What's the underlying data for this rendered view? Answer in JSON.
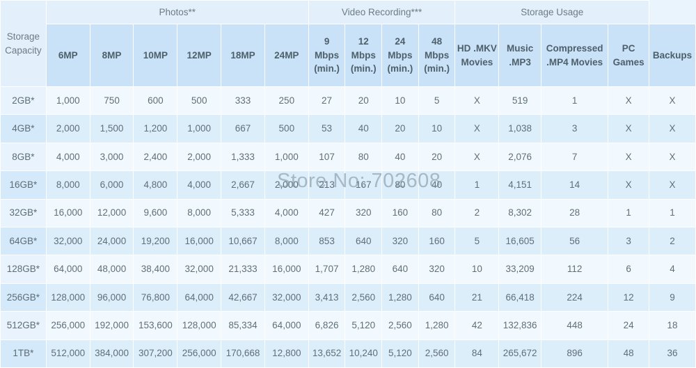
{
  "table": {
    "stub_header": [
      "Storage",
      "Capacity"
    ],
    "group_headers": [
      {
        "label": "Photos**",
        "span": 6
      },
      {
        "label": "Video Recording***",
        "span": 4
      },
      {
        "label": "Storage Usage",
        "span": 4
      }
    ],
    "column_headers": [
      {
        "lines": [
          "6MP"
        ]
      },
      {
        "lines": [
          "8MP"
        ]
      },
      {
        "lines": [
          "10MP"
        ]
      },
      {
        "lines": [
          "12MP"
        ]
      },
      {
        "lines": [
          "18MP"
        ]
      },
      {
        "lines": [
          "24MP"
        ]
      },
      {
        "lines": [
          "9",
          "Mbps",
          "(min.)"
        ]
      },
      {
        "lines": [
          "12",
          "Mbps",
          "(min.)"
        ]
      },
      {
        "lines": [
          "24",
          "Mbps",
          "(min.)"
        ]
      },
      {
        "lines": [
          "48",
          "Mbps",
          "(min.)"
        ]
      },
      {
        "lines": [
          "HD .MKV",
          "Movies"
        ]
      },
      {
        "lines": [
          "Music",
          ".MP3"
        ]
      },
      {
        "lines": [
          "Compressed",
          ".MP4 Movies"
        ]
      },
      {
        "lines": [
          "PC",
          "Games"
        ]
      },
      {
        "lines": [
          "Backups"
        ]
      }
    ],
    "rows": [
      {
        "capacity": "2GB*",
        "values": [
          "1,000",
          "750",
          "600",
          "500",
          "333",
          "250",
          "27",
          "20",
          "10",
          "5",
          "X",
          "519",
          "1",
          "X",
          "X"
        ]
      },
      {
        "capacity": "4GB*",
        "values": [
          "2,000",
          "1,500",
          "1,200",
          "1,000",
          "667",
          "500",
          "53",
          "40",
          "20",
          "10",
          "X",
          "1,038",
          "3",
          "X",
          "X"
        ]
      },
      {
        "capacity": "8GB*",
        "values": [
          "4,000",
          "3,000",
          "2,400",
          "2,000",
          "1,333",
          "1,000",
          "107",
          "80",
          "40",
          "20",
          "X",
          "2,076",
          "7",
          "X",
          "X"
        ]
      },
      {
        "capacity": "16GB*",
        "values": [
          "8,000",
          "6,000",
          "4,800",
          "4,000",
          "2,667",
          "2,000",
          "213",
          "167",
          "80",
          "40",
          "1",
          "4,151",
          "14",
          "X",
          "X"
        ]
      },
      {
        "capacity": "32GB*",
        "values": [
          "16,000",
          "12,000",
          "9,600",
          "8,000",
          "5,333",
          "4,000",
          "427",
          "320",
          "160",
          "80",
          "2",
          "8,302",
          "28",
          "1",
          "1"
        ]
      },
      {
        "capacity": "64GB*",
        "values": [
          "32,000",
          "24,000",
          "19,200",
          "16,000",
          "10,667",
          "8,000",
          "853",
          "640",
          "320",
          "160",
          "5",
          "16,605",
          "56",
          "3",
          "2"
        ]
      },
      {
        "capacity": "128GB*",
        "values": [
          "64,000",
          "48,000",
          "38,400",
          "32,000",
          "21,333",
          "16,000",
          "1,707",
          "1,280",
          "640",
          "320",
          "10",
          "33,209",
          "112",
          "6",
          "4"
        ]
      },
      {
        "capacity": "256GB*",
        "values": [
          "128,000",
          "96,000",
          "76,800",
          "64,000",
          "42,667",
          "32,000",
          "3,413",
          "2,560",
          "1,280",
          "640",
          "21",
          "66,418",
          "224",
          "12",
          "9"
        ]
      },
      {
        "capacity": "512GB*",
        "values": [
          "256,000",
          "192,000",
          "153,600",
          "128,000",
          "85,334",
          "64,000",
          "6,826",
          "5,120",
          "2,560",
          "1,280",
          "42",
          "132,836",
          "448",
          "24",
          "18"
        ]
      },
      {
        "capacity": "1TB*",
        "values": [
          "512,000",
          "384,000",
          "307,200",
          "256,000",
          "170,668",
          "12,800",
          "13,652",
          "10,240",
          "5,120",
          "2,560",
          "84",
          "265,672",
          "896",
          "48",
          "36"
        ]
      }
    ]
  },
  "watermark": {
    "text": "Store No: 702608"
  },
  "colors": {
    "group_header_bg": "#e3f0fb",
    "sub_header_bg": "#c9e2f7",
    "row_odd_bg": "#f2f9fe",
    "row_even_bg": "#ddeefb",
    "text": "#5f6f78"
  }
}
